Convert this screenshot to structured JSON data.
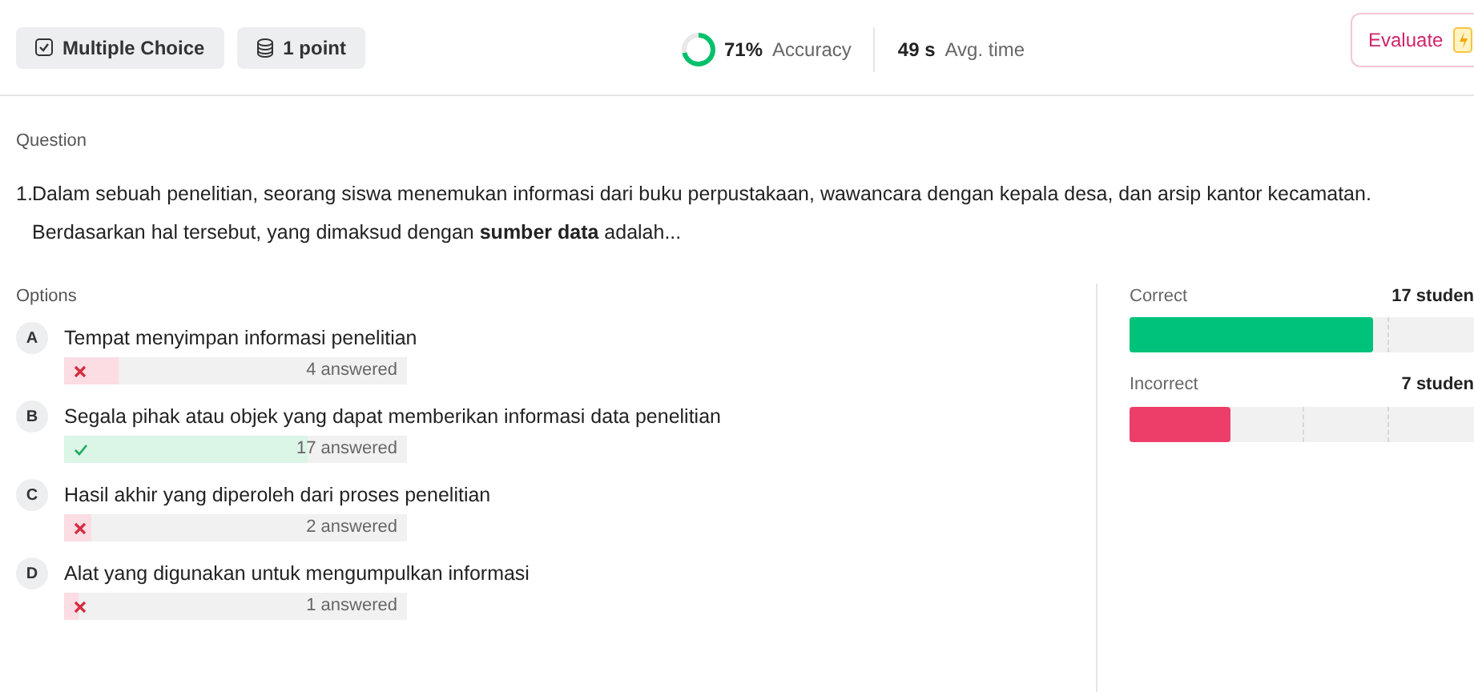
{
  "header": {
    "tags": [
      {
        "kind": "type",
        "label": "Multiple Choice"
      },
      {
        "kind": "points",
        "label": "1 point"
      }
    ],
    "accuracy": {
      "level": 0.71,
      "value": "71%",
      "label": "Accuracy"
    },
    "avg_time": {
      "value": "49 s",
      "label": "Avg. time"
    },
    "evaluate_button": {
      "label": "Evaluate"
    }
  },
  "question": {
    "heading": "Question",
    "number": "1.",
    "text": "Dalam sebuah penelitian, seorang siswa menemukan informasi dari buku perpustakaan, wawancara dengan kepala desa, dan arsip kantor kecamatan. Berdasarkan hal tersebut, yang dimaksud dengan **sumber data** adalah..."
  },
  "options": {
    "heading": "Options",
    "items": [
      {
        "letter": "A",
        "text": "Tempat menyimpan informasi penelitian",
        "correct": false,
        "level": 0.16,
        "answered": "4 answered"
      },
      {
        "letter": "B",
        "text": "Segala pihak atau objek yang dapat memberikan informasi data penelitian",
        "correct": true,
        "level": 0.71,
        "answered": "17 answered"
      },
      {
        "letter": "C",
        "text": "Hasil akhir yang diperoleh dari proses penelitian",
        "correct": false,
        "level": 0.08,
        "answered": "2 answered"
      },
      {
        "letter": "D",
        "text": "Alat yang digunakan untuk mengumpulkan informasi",
        "correct": false,
        "level": 0.04,
        "answered": "1 answered"
      }
    ]
  },
  "summary": [
    {
      "kind": "correct",
      "label": "Correct",
      "count": "17 studen",
      "level": 0.708
    },
    {
      "kind": "incorrect",
      "label": "Incorrect",
      "count": "7 studen",
      "level": 0.292
    }
  ]
}
